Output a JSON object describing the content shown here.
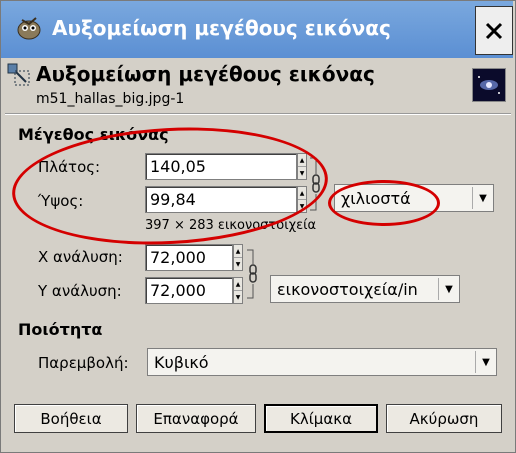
{
  "window": {
    "title": "Αυξομείωση μεγέθους εικόνας"
  },
  "header": {
    "title": "Αυξομείωση μεγέθους εικόνας",
    "subtitle": "m51_hallas_big.jpg-1"
  },
  "size": {
    "section": "Μέγεθος εικόνας",
    "width_label": "Πλάτος:",
    "width_value": "140,05",
    "height_label": "Ύψος:",
    "height_value": "99,84",
    "pixel_info": "397 × 283 εικονοστοιχεία",
    "unit": "χιλιοστά"
  },
  "resolution": {
    "x_label": "X ανάλυση:",
    "x_value": "72,000",
    "y_label": "Y ανάλυση:",
    "y_value": "72,000",
    "unit": "εικονοστοιχεία/in"
  },
  "quality": {
    "section": "Ποιότητα",
    "interp_label": "Παρεμβολή:",
    "interp_value": "Κυβικό"
  },
  "buttons": {
    "help": "Βοήθεια",
    "reset": "Επαναφορά",
    "scale": "Κλίμακα",
    "cancel": "Ακύρωση"
  },
  "colors": {
    "titlebar": "#6b9bd8",
    "annotation": "#d40000"
  }
}
